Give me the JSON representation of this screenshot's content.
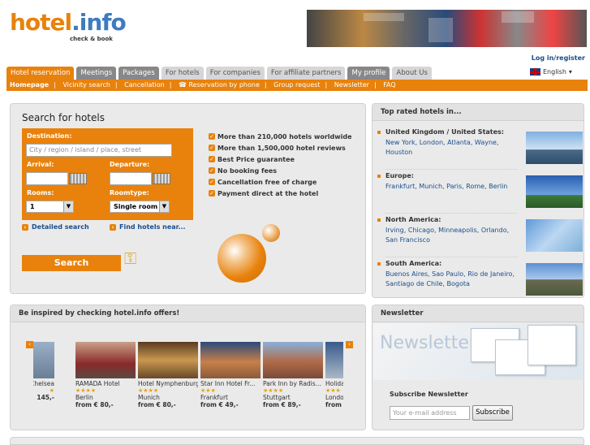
{
  "header": {
    "logo_main_a": "hotel",
    "logo_main_b": ".info",
    "logo_tag": "check & book",
    "login": "Log in/register",
    "language": "English"
  },
  "tabs": [
    {
      "label": "Hotel reservation"
    },
    {
      "label": "Meetings"
    },
    {
      "label": "Packages"
    },
    {
      "label": "For hotels"
    },
    {
      "label": "For companies"
    },
    {
      "label": "For affiliate partners"
    },
    {
      "label": "My profile"
    },
    {
      "label": "About Us"
    }
  ],
  "subnav": [
    "Homepage",
    "Vicinity search",
    "Cancellation",
    "☎ Reservation by phone",
    "Group request",
    "Newsletter",
    "FAQ"
  ],
  "search": {
    "title": "Search for hotels",
    "destination_label": "Destination:",
    "destination_placeholder": "City / region / island / place, street",
    "arrival_label": "Arrival:",
    "departure_label": "Departure:",
    "rooms_label": "Rooms:",
    "rooms_value": "1",
    "roomtype_label": "Roomtype:",
    "roomtype_value": "Single room",
    "detailed_search": "Detailed search",
    "find_near": "Find hotels near...",
    "button": "Search",
    "features": [
      "More than 210,000 hotels worldwide",
      "More than 1,500,000 hotel reviews",
      "Best Price guarantee",
      "No booking fees",
      "Cancellation free of charge",
      "Payment direct at the hotel"
    ]
  },
  "toprated": {
    "title": "Top rated hotels in...",
    "regions": [
      {
        "name": "United Kingdom / United States:",
        "cities": "New York, London, Atlanta, Wayne, Houston"
      },
      {
        "name": "Europe:",
        "cities": "Frankfurt, Munich, Paris, Rome, Berlin"
      },
      {
        "name": "North America:",
        "cities": "Irving, Chicago, Minneapolis, Orlando, San Francisco"
      },
      {
        "name": "South America:",
        "cities": "Buenos Aires, Sao Paulo, Rio de Janeiro, Santiago de Chile, Bogota"
      }
    ]
  },
  "offers": {
    "title": "Be inspired by checking hotel.info offers!",
    "hotels": [
      {
        "name": "a Chelsea",
        "stars": "★",
        "city": "",
        "price": "145,-"
      },
      {
        "name": "RAMADA Hotel",
        "stars": "★★★★",
        "city": "Berlin",
        "price": "from € 80,-"
      },
      {
        "name": "Hotel Nymphenburg",
        "stars": "★★★★",
        "city": "Munich",
        "price": "from € 80,-"
      },
      {
        "name": "Star Inn Hotel Fr...",
        "stars": "★★★",
        "city": "Frankfurt",
        "price": "from € 49,-"
      },
      {
        "name": "Park Inn by Radis...",
        "stars": "★★★★",
        "city": "Stuttgart",
        "price": "from € 89,-"
      },
      {
        "name": "Holiday",
        "stars": "★★★",
        "city": "London",
        "price": "from €"
      }
    ]
  },
  "newsletter": {
    "title": "Newsletter",
    "image_text": "Newsletter",
    "subscribe_title": "Subscribe Newsletter",
    "input_placeholder": "Your e-mail address",
    "button": "Subscribe"
  },
  "colors": {
    "accent": "#e8820c",
    "link": "#1a4e8c",
    "panel": "#eaeaea"
  }
}
